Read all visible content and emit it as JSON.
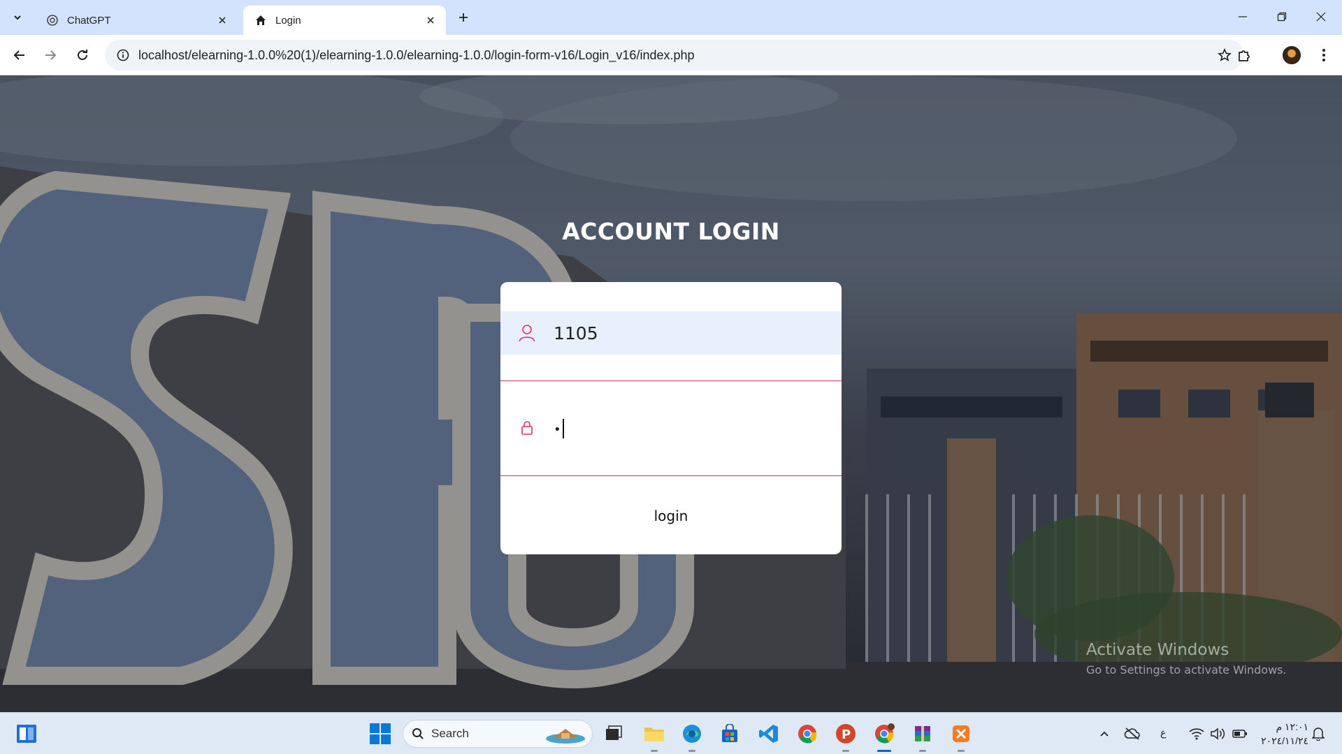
{
  "browser": {
    "tabs": [
      {
        "title": "ChatGPT",
        "icon": "openai-icon",
        "active": false
      },
      {
        "title": "Login",
        "icon": "home-icon",
        "active": true
      }
    ],
    "url": "localhost/elearning-1.0.0%20(1)/elearning-1.0.0/elearning-1.0.0/login-form-v16/Login_v16/index.php"
  },
  "page": {
    "title": "ACCOUNT LOGIN",
    "username_value": "1105",
    "password_value": "•",
    "login_label": "login",
    "accent_color": "#d6336c",
    "background_letters": "SPU"
  },
  "watermark": {
    "line1": "Activate Windows",
    "line2": "Go to Settings to activate Windows."
  },
  "taskbar": {
    "search_label": "Search",
    "apps": [
      "file-explorer-icon",
      "task-view-icon",
      "edge-icon",
      "store-icon",
      "vscode-icon",
      "chrome-icon",
      "powerpoint-icon",
      "chrome-profile-icon",
      "winrar-icon",
      "xampp-icon"
    ],
    "language": "ع",
    "time": "١٢:٠١ م",
    "date": "٢٠٢٤/١١/٢٤"
  }
}
